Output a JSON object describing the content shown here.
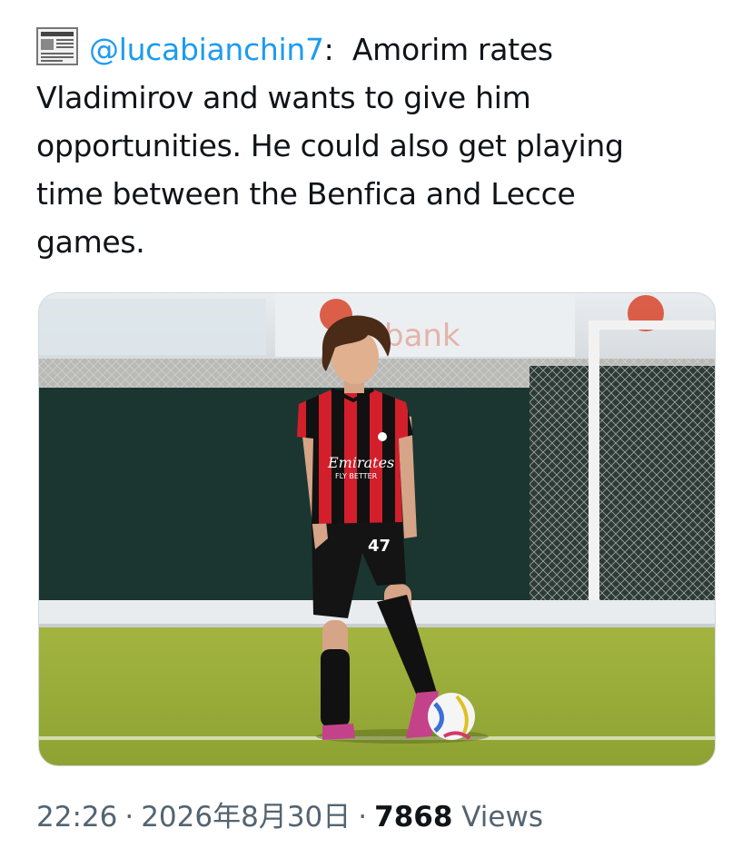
{
  "tweet": {
    "source_icon": "newspaper-icon",
    "mention": "@lucabianchin7",
    "text_line1_suffix": ":  Amorim rates",
    "text_rest": "Vladimirov and wants to give him opportunities. He could also get playing time between the Benfica and Lecce games."
  },
  "media": {
    "type": "photo",
    "shirt_sponsor": "Emirates",
    "shirt_tagline": "FLY BETTER",
    "shirt_number": "47",
    "banner_text": "bank"
  },
  "meta": {
    "time": "22:26",
    "separator": "·",
    "date": "2026年8月30日",
    "views_count": "7868",
    "views_label": "Views"
  },
  "colors": {
    "mention": "#1d9bf0",
    "text": "#0f1419",
    "secondary": "#536471",
    "jersey_red": "#d21f2b",
    "jersey_black": "#111111"
  }
}
